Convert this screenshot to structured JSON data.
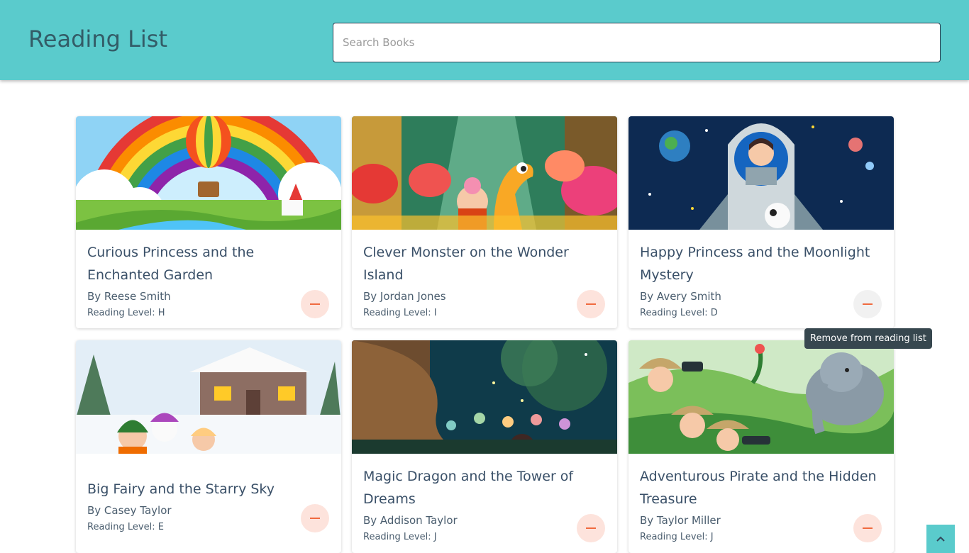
{
  "header": {
    "title": "Reading List",
    "search_placeholder": "Search Books",
    "search_value": ""
  },
  "books": [
    {
      "title": "Curious Princess and the Enchanted Garden",
      "author": "By Reese Smith",
      "level": "Reading Level: H",
      "cover": "rainbow-balloon-cover"
    },
    {
      "title": "Clever Monster on the Wonder Island",
      "author": "By Jordan Jones",
      "level": "Reading Level: I",
      "cover": "forest-dragon-cover"
    },
    {
      "title": "Happy Princess and the Moonlight Mystery",
      "author": "By Avery Smith",
      "level": "Reading Level: D",
      "cover": "space-rocket-cover"
    },
    {
      "title": "Big Fairy and the Starry Sky",
      "author": "By Casey Taylor",
      "level": "Reading Level: E",
      "cover": "snowy-cabin-cover"
    },
    {
      "title": "Magic Dragon and the Tower of Dreams",
      "author": "By Addison Taylor",
      "level": "Reading Level: J",
      "cover": "magic-tree-cover"
    },
    {
      "title": "Adventurous Pirate and the Hidden Treasure",
      "author": "By Taylor Miller",
      "level": "Reading Level: J",
      "cover": "jungle-explorers-cover"
    }
  ],
  "tooltip": "Remove from reading list",
  "icons": {
    "remove": "minus-icon",
    "scroll_top": "chevron-up-icon"
  },
  "colors": {
    "header": "#5acbcc",
    "remove_button_bg": "#fde3dc",
    "remove_icon": "#f06a3f",
    "tooltip_bg": "#37474f"
  }
}
